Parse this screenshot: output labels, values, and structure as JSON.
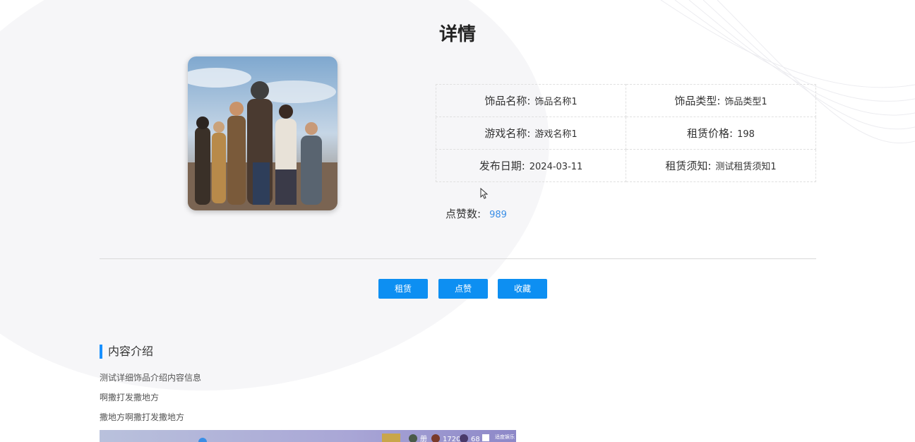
{
  "page": {
    "title": "详情"
  },
  "details": {
    "rows": [
      [
        {
          "label": "饰品名称:",
          "value": "饰品名称1"
        },
        {
          "label": "饰品类型:",
          "value": "饰品类型1"
        }
      ],
      [
        {
          "label": "游戏名称:",
          "value": "游戏名称1"
        },
        {
          "label": "租赁价格:",
          "value": "198"
        }
      ],
      [
        {
          "label": "发布日期:",
          "value": "2024-03-11"
        },
        {
          "label": "租赁须知:",
          "value": "测试租赁须知1"
        }
      ]
    ]
  },
  "likes": {
    "label": "点赞数:",
    "value": "989"
  },
  "actions": {
    "rent": "租赁",
    "like": "点赞",
    "favorite": "收藏"
  },
  "content": {
    "heading": "内容介绍",
    "lines": [
      "测试详细饰品介绍内容信息",
      "啊撒打发撒地方",
      "撒地方啊撒打发撒地方"
    ],
    "image_overlay": {
      "stat1": "册",
      "stat2": "1720",
      "stat3": "68",
      "corner": "适度娱乐"
    }
  },
  "colors": {
    "accent": "#0d8ff2",
    "link": "#3a8ee6",
    "section_bar": "#1890ff"
  }
}
